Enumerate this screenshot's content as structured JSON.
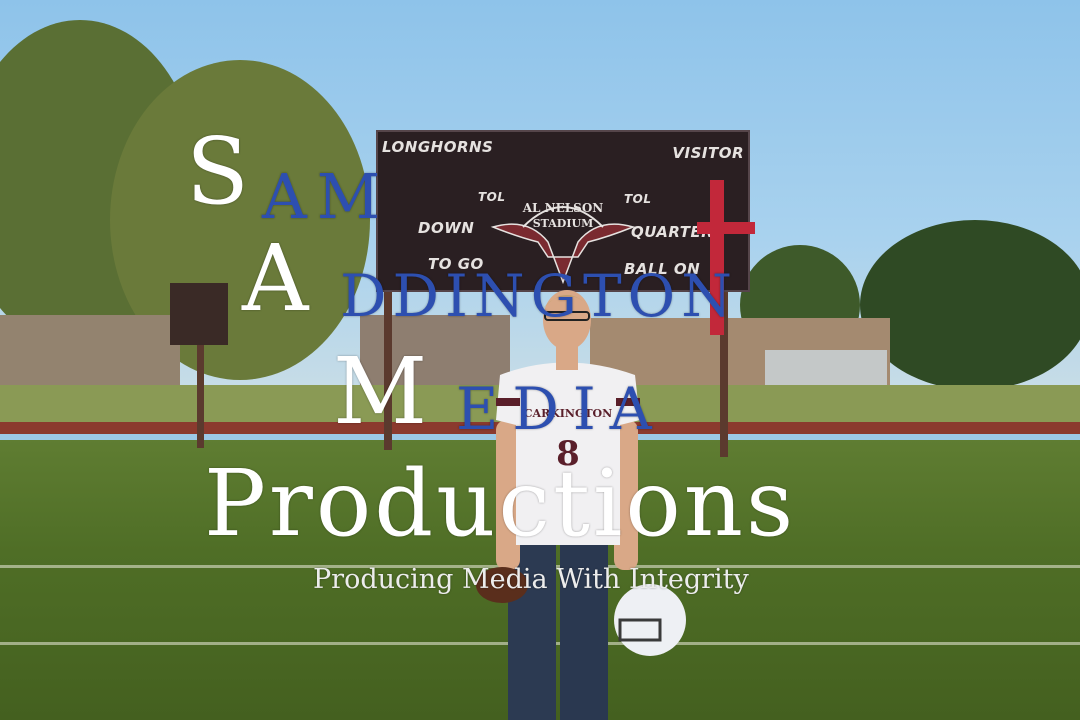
{
  "scoreboard": {
    "home_label": "LONGHORNS",
    "visitor_label": "VISITOR",
    "tol_left": "TOL",
    "tol_right": "TOL",
    "down_label": "DOWN",
    "quarter_label": "QUARTER",
    "togo_label": "TO GO",
    "ballon_label": "BALL ON",
    "stadium_line1": "AL NELSON",
    "stadium_line2": "STADIUM"
  },
  "player": {
    "jersey_text": "CARKINGTON",
    "jersey_number": "8"
  },
  "watermark": {
    "line1_initial": "S",
    "line1_rest": "AM",
    "line2_initial": "A",
    "line2_rest": "DDINGTON",
    "line3_initial": "M",
    "line3_rest": "EDIA",
    "title": "Productions",
    "tagline": "Producing Media With Integrity"
  },
  "colors": {
    "watermark_white": "#ffffff",
    "watermark_blue": "#2d4fb0",
    "cross_red": "#c2283a",
    "jersey_maroon": "#5a1f2a"
  }
}
